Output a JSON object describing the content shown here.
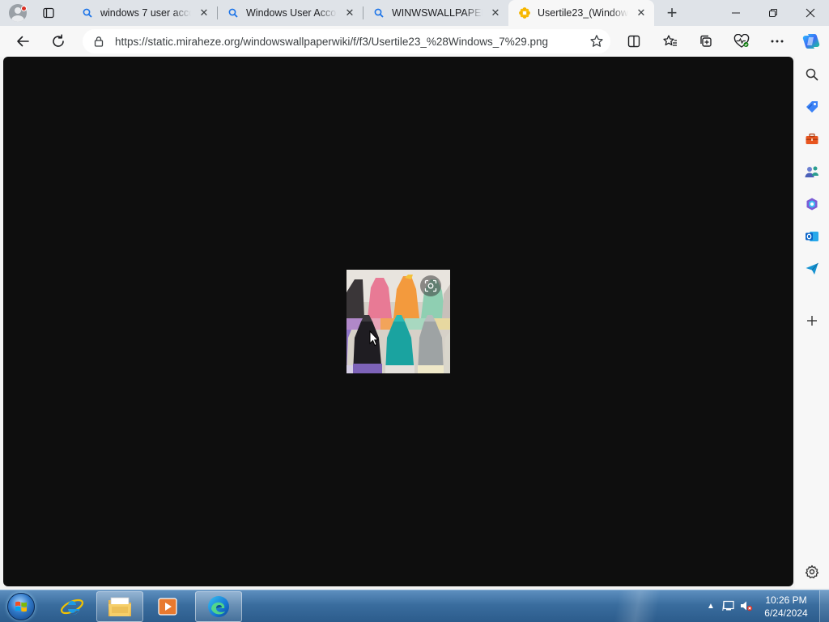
{
  "browser": {
    "tabs": [
      {
        "title": "windows 7 user accou",
        "icon": "search-icon",
        "active": false
      },
      {
        "title": "Windows User Accou",
        "icon": "search-icon",
        "active": false
      },
      {
        "title": "WINWSWALLPAPERW",
        "icon": "search-icon",
        "active": false
      },
      {
        "title": "Usertile23_(Windows_",
        "icon": "flower-favicon",
        "active": true
      }
    ],
    "close_glyph": "✕",
    "new_tab_glyph": "+",
    "address": {
      "url": "https://static.miraheze.org/windowswallpaperwiki/f/f3/Usertile23_%28Windows_7%29.png"
    }
  },
  "content": {
    "image_name": "Usertile23 (Windows 7)",
    "background": "#0e0e0e"
  },
  "sidebar": {
    "items": [
      "search-icon",
      "shopping-tag-icon",
      "toolbox-icon",
      "people-icon",
      "office-icon",
      "outlook-icon",
      "send-icon",
      "add-icon",
      "settings-icon"
    ]
  },
  "taskbar": {
    "apps": [
      "internet-explorer-icon",
      "file-explorer-icon",
      "media-player-icon",
      "edge-icon"
    ],
    "clock": {
      "time": "10:26 PM",
      "date": "6/24/2024"
    },
    "tray_arrow": "▲"
  },
  "colors": {
    "accent": "#0078d4",
    "taskbar": "#3a6d9e",
    "viewport": "#0e0e0e"
  }
}
